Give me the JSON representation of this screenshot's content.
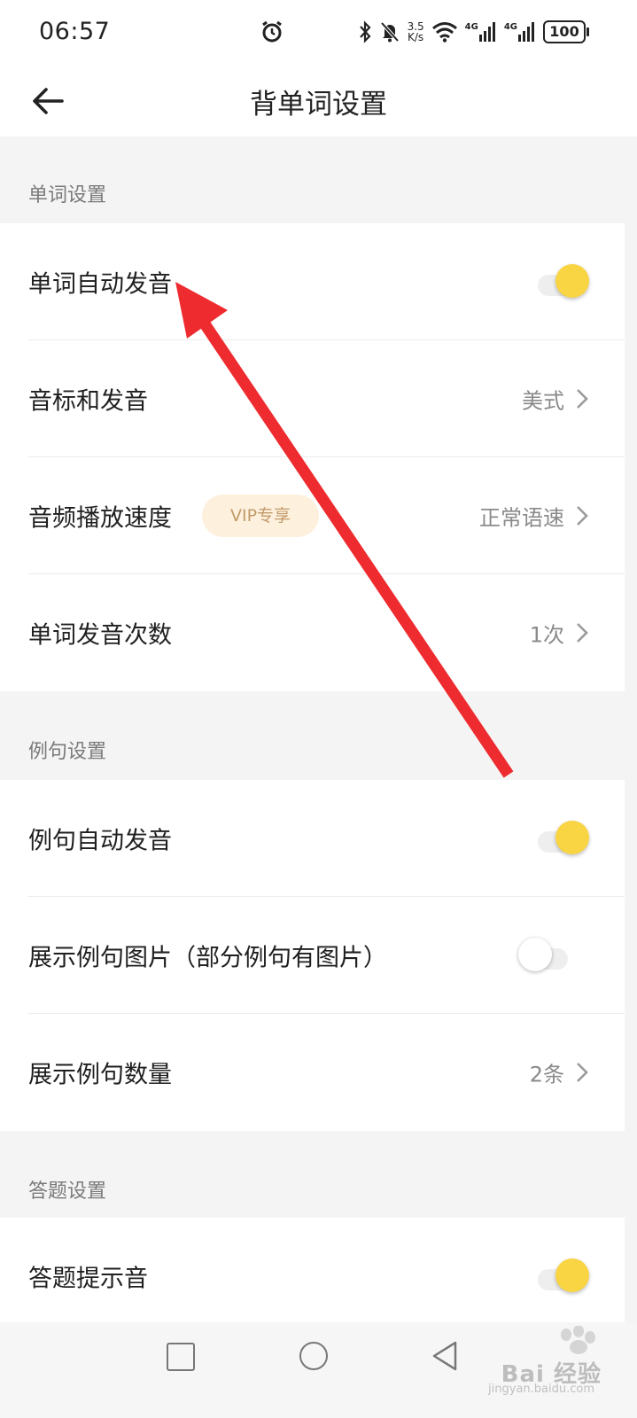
{
  "status_bar": {
    "time": "06:57",
    "net_speed_value": "3.5",
    "net_speed_unit": "K/s",
    "network_1": "4G",
    "network_2": "4G",
    "battery": "100"
  },
  "header": {
    "title": "背单词设置"
  },
  "sections": [
    {
      "title": "单词设置",
      "items": [
        {
          "label": "单词自动发音",
          "control": "toggle",
          "on": true
        },
        {
          "label": "音标和发音",
          "control": "select",
          "value": "美式"
        },
        {
          "label": "音频播放速度",
          "badge": "VIP专享",
          "control": "select",
          "value": "正常语速"
        },
        {
          "label": "单词发音次数",
          "control": "select",
          "value": "1次"
        }
      ]
    },
    {
      "title": "例句设置",
      "items": [
        {
          "label": "例句自动发音",
          "control": "toggle",
          "on": true
        },
        {
          "label": "展示例句图片（部分例句有图片）",
          "control": "toggle",
          "on": false
        },
        {
          "label": "展示例句数量",
          "control": "select",
          "value": "2条"
        }
      ]
    },
    {
      "title": "答题设置",
      "items": [
        {
          "label": "答题提示音",
          "control": "toggle",
          "on": true
        }
      ]
    }
  ],
  "watermark": {
    "brand": "Bai 经验",
    "url": "jingyan.baidu.com"
  },
  "colors": {
    "toggle_on": "#f9d443",
    "vip_badge_bg": "#fdf1de",
    "vip_badge_text": "#c29a6a",
    "annotation_arrow": "#ee2b2f"
  },
  "icons": [
    "back-arrow-icon",
    "alarm-icon",
    "bluetooth-icon",
    "mute-icon",
    "wifi-icon",
    "signal-icon",
    "chevron-right-icon",
    "recent-apps-icon",
    "home-icon",
    "nav-back-icon"
  ]
}
